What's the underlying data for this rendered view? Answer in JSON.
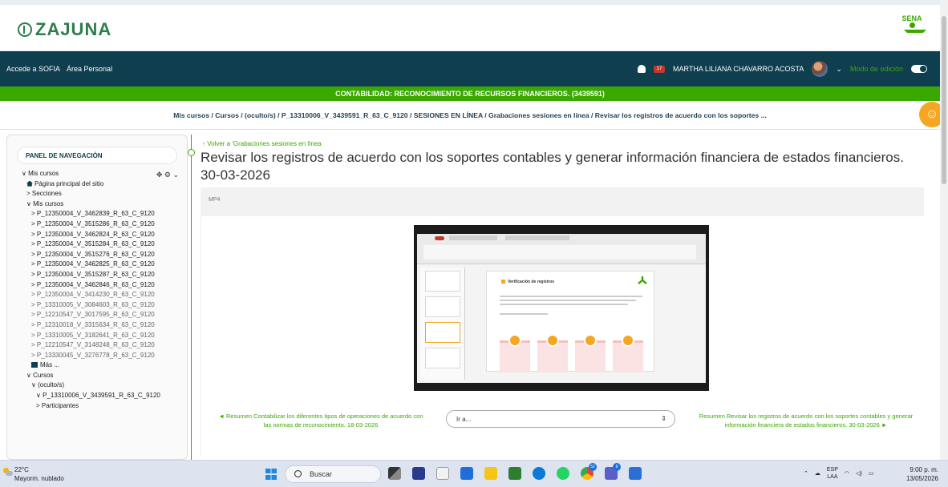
{
  "header": {
    "logo_text": "ZAJUNA",
    "sena_logo_text": "SENA"
  },
  "navbar": {
    "links": [
      "Accede a SOFIA",
      "Área Personal"
    ],
    "notifications_count": "17",
    "user_name": "MARTHA LILIANA CHAVARRO ACOSTA",
    "edit_mode_label": "Modo de edición"
  },
  "course_title": "CONTABILIDAD: RECONOCIMIENTO DE RECURSOS FINANCIEROS. (3439591)",
  "breadcrumb": "Mis cursos / Cursos / (oculto/s) / P_13310006_V_3439591_R_63_C_9120 / SESIONES EN LÍNEA / Grabaciones sesiones en línea / Revisar los registros de acuerdo con los soportes ...",
  "sidebar": {
    "heading": "PANEL DE NAVEGACIÓN",
    "items": [
      {
        "label": "Mis cursos",
        "prefix": "∨",
        "level": 0
      },
      {
        "label": "Página principal del sitio",
        "prefix": "home",
        "level": 1
      },
      {
        "label": "Secciones",
        "prefix": ">",
        "level": 1
      },
      {
        "label": "Mis cursos",
        "prefix": "∨",
        "level": 1
      },
      {
        "label": "P_12350004_V_3462839_R_63_C_9120",
        "prefix": ">",
        "level": 2
      },
      {
        "label": "P_12350004_V_3515286_R_63_C_9120",
        "prefix": ">",
        "level": 2
      },
      {
        "label": "P_12350004_V_3462824_R_63_C_9120",
        "prefix": ">",
        "level": 2
      },
      {
        "label": "P_12350004_V_3515284_R_63_C_9120",
        "prefix": ">",
        "level": 2
      },
      {
        "label": "P_12350004_V_3515276_R_63_C_9120",
        "prefix": ">",
        "level": 2
      },
      {
        "label": "P_12350004_V_3462825_R_63_C_9120",
        "prefix": ">",
        "level": 2
      },
      {
        "label": "P_12350004_V_3515287_R_63_C_9120",
        "prefix": ">",
        "level": 2
      },
      {
        "label": "P_12350004_V_3462846_R_63_C_9120",
        "prefix": ">",
        "level": 2
      },
      {
        "label": "P_12350004_V_3414230_R_63_C_9120",
        "prefix": ">",
        "level": 2,
        "muted": true
      },
      {
        "label": "P_13310005_V_3084603_R_63_C_9120",
        "prefix": ">",
        "level": 2,
        "muted": true
      },
      {
        "label": "P_12210547_V_3017595_R_63_C_9120",
        "prefix": ">",
        "level": 2,
        "muted": true
      },
      {
        "label": "P_12310018_V_3315634_R_63_C_9120",
        "prefix": ">",
        "level": 2,
        "muted": true
      },
      {
        "label": "P_13310005_V_3182641_R_63_C_9120",
        "prefix": ">",
        "level": 2,
        "muted": true
      },
      {
        "label": "P_12210547_V_3148248_R_63_C_9120",
        "prefix": ">",
        "level": 2,
        "muted": true
      },
      {
        "label": "P_13330045_V_3276778_R_63_C_9120",
        "prefix": ">",
        "level": 2,
        "muted": true
      },
      {
        "label": "Más ...",
        "prefix": "more",
        "level": 2
      },
      {
        "label": "Cursos",
        "prefix": "∨",
        "level": 1
      },
      {
        "label": "(oculto/s)",
        "prefix": "∨",
        "level": 2
      },
      {
        "label": "P_13310006_V_3439591_R_63_C_9120",
        "prefix": "∨",
        "level": 3
      },
      {
        "label": "Participantes",
        "prefix": ">",
        "level": 3
      }
    ]
  },
  "main": {
    "back_link": "Volver a 'Grabaciones sesiones en línea",
    "title": "Revisar los registros de acuerdo con los soportes contables y generar información financiera de estados financieros. 30-03-2026",
    "format": "MP4",
    "slide_title": "Verificación de registros"
  },
  "bottom_nav": {
    "prev": "◄ Resumen Contabilizar los diferentes tipos de operaciones de acuerdo con las normas de reconocimiento. 18-03-2026",
    "jump_placeholder": "Ir a...",
    "next": "Resumen Revisar los registros de acuerdo con los soportes contables y generar información financiera de estados financieros. 30-03-2026 ►"
  },
  "taskbar": {
    "weather_temp": "22°C",
    "weather_desc": "Mayorm. nublado",
    "search_label": "Buscar",
    "lang_top": "ESP",
    "lang_bottom": "LAA",
    "time": "9:00 p. m.",
    "date": "13/05/2026",
    "chrome_badge": "52",
    "teams_badge": "8"
  },
  "colors": {
    "navbar": "#0f3e4e",
    "accent_green": "#39a900",
    "accent_orange": "#f5a623"
  }
}
